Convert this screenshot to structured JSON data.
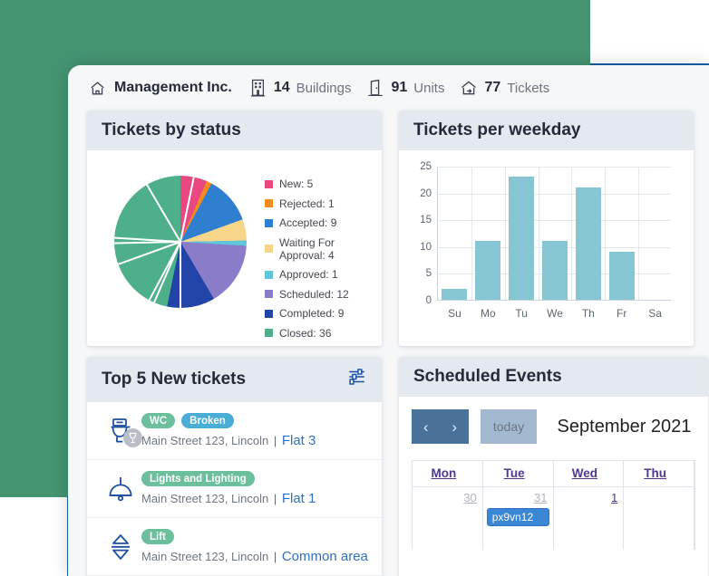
{
  "background": {
    "green": "#449472",
    "blue_rule": "#1463ac",
    "panel": "#f6f7f9"
  },
  "topbar": {
    "home_icon": "home-icon",
    "brand": "Management Inc.",
    "stats": [
      {
        "icon": "building-icon",
        "count": "14",
        "label": "Buildings"
      },
      {
        "icon": "door-icon",
        "count": "91",
        "label": "Units"
      },
      {
        "icon": "house-ticket-icon",
        "count": "77",
        "label": "Tickets"
      }
    ]
  },
  "cards": {
    "status": {
      "title": "Tickets by status"
    },
    "weekday": {
      "title": "Tickets per weekday"
    },
    "tickets": {
      "title": "Top 5 New tickets",
      "filter_icon": "filter-sliders-icon"
    },
    "events": {
      "title": "Scheduled Events"
    }
  },
  "chart_data": [
    {
      "type": "pie",
      "title": "Tickets by status",
      "legend_position": "right",
      "categories": [
        "New",
        "Rejected",
        "Accepted",
        "Waiting For Approval",
        "Approved",
        "Scheduled",
        "Completed",
        "Closed"
      ],
      "values": [
        5,
        1,
        9,
        4,
        1,
        12,
        9,
        36
      ],
      "colors": [
        "#e8477f",
        "#f58b1e",
        "#2f7fd1",
        "#f7d68a",
        "#5fc6da",
        "#8a7cc8",
        "#2244a8",
        "#4db08a"
      ],
      "labels": [
        "New: 5",
        "Rejected: 1",
        "Accepted: 9",
        "Waiting For Approval: 4",
        "Approved: 1",
        "Scheduled: 12",
        "Completed: 9",
        "Closed: 36"
      ],
      "total": 77
    },
    {
      "type": "bar",
      "title": "Tickets per weekday",
      "categories": [
        "Su",
        "Mo",
        "Tu",
        "We",
        "Th",
        "Fr",
        "Sa"
      ],
      "values": [
        2,
        11,
        23,
        11,
        21,
        9,
        0
      ],
      "xlabel": "",
      "ylabel": "",
      "ylim": [
        0,
        25
      ],
      "yticks": [
        0,
        5,
        10,
        15,
        20,
        25
      ],
      "bar_color": "#86c5d2",
      "grid": true
    }
  ],
  "tickets": [
    {
      "icon": "toilet-icon",
      "badge_icon": "glass-icon",
      "tags": [
        {
          "text": "WC",
          "color": "#6cbf9b"
        },
        {
          "text": "Broken",
          "color": "#4aadd6"
        }
      ],
      "address": "Main Street 123, Lincoln",
      "separator": "|",
      "unit": "Flat 3"
    },
    {
      "icon": "pendant-lamp-icon",
      "badge_icon": "",
      "tags": [
        {
          "text": "Lights and Lighting",
          "color": "#6cbf9b"
        }
      ],
      "address": "Main Street 123, Lincoln",
      "separator": "|",
      "unit": "Flat 1"
    },
    {
      "icon": "elevator-icon",
      "badge_icon": "",
      "tags": [
        {
          "text": "Lift",
          "color": "#6cbf9b"
        }
      ],
      "address": "Main Street 123, Lincoln",
      "separator": "|",
      "unit": "Common area"
    }
  ],
  "calendar": {
    "prev_label": "‹",
    "next_label": "›",
    "today_label": "today",
    "title": "September 2021",
    "day_headers": [
      "Mon",
      "Tue",
      "Wed",
      "Thu"
    ],
    "days": [
      {
        "num": "30",
        "current_month": false,
        "events": []
      },
      {
        "num": "31",
        "current_month": false,
        "events": [
          {
            "title": "px9vn12",
            "color": "#3a87d6"
          }
        ]
      },
      {
        "num": "1",
        "current_month": true,
        "events": []
      },
      {
        "num": "",
        "current_month": true,
        "events": []
      }
    ]
  }
}
